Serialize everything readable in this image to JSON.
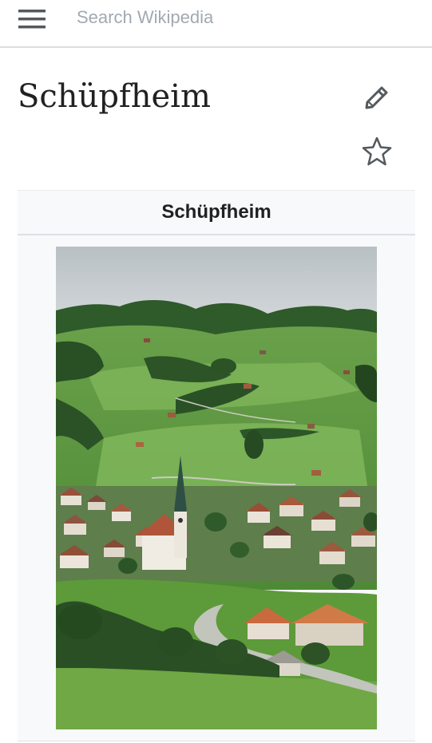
{
  "header": {
    "menu_icon": "hamburger-menu-icon",
    "search_placeholder": "Search Wikipedia"
  },
  "page": {
    "title": "Schüpfheim",
    "edit_icon": "pencil-icon",
    "watch_icon": "star-outline-icon"
  },
  "infobox": {
    "title": "Schüpfheim",
    "image_subject": "village landscape with church steeple, green hills and forest"
  },
  "colors": {
    "text": "#202122",
    "icon": "#54595d",
    "placeholder": "#a2a9b1",
    "infobox_bg": "#f8f9fa",
    "divider": "#dadcde"
  }
}
